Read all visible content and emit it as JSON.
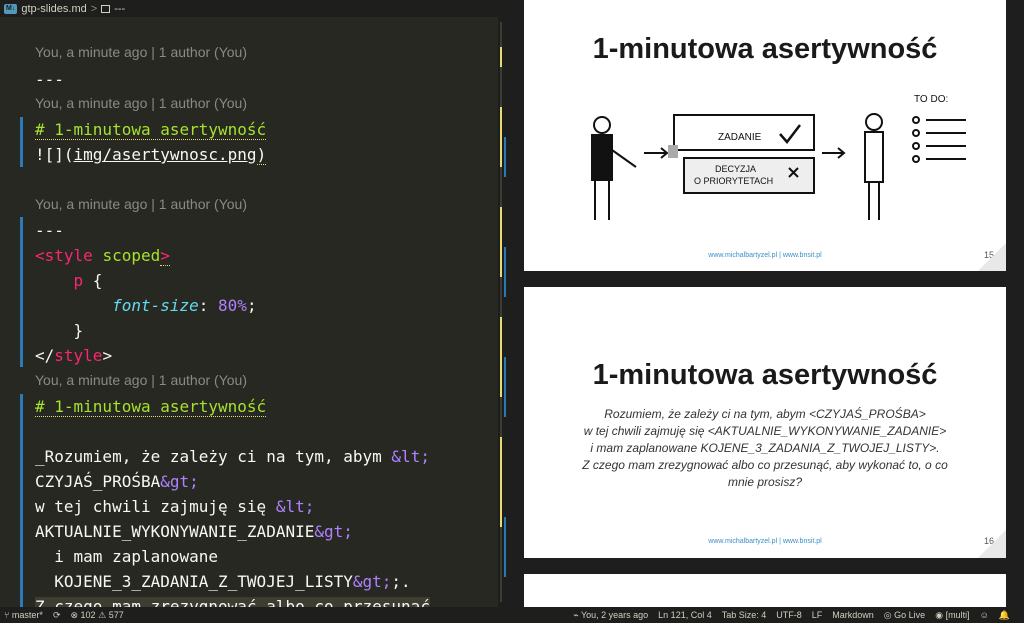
{
  "tab": {
    "filename": "gtp-slides.md",
    "breadcrumb_sep": ">",
    "breadcrumb_more": "---",
    "badge": "M↓"
  },
  "blame": {
    "b1": "You, a minute ago | 1 author (You)",
    "b2": "You, a minute ago | 1 author (You)",
    "b3": "You, a minute ago | 1 author (You)",
    "b4": "You, a minute ago | 1 author (You)"
  },
  "code": {
    "sep1": "---",
    "heading1": "# 1-minutowa asertywność",
    "img_prefix": "![](",
    "img_path": "img/asertywnosc.png",
    "img_suffix": ")",
    "sep2": "---",
    "style_lt": "<",
    "style_tag": "style",
    "style_attr": "scoped",
    "style_gt": ">",
    "p_sel": "p",
    "p_brace": " {",
    "fs_prop": "font-size",
    "fs_colon": ": ",
    "fs_val": "80%",
    "fs_semi": ";",
    "close_brace": "}",
    "style_close_lt": "</",
    "style_close_tag": "style",
    "style_close_gt": ">",
    "heading2": "# 1-minutowa asertywność",
    "t1a": "_Rozumiem, że zależy ci na tym, abym ",
    "t1b": "&lt;",
    "t2a": "CZYJAŚ_PROŚBA",
    "t2b": "&gt;",
    "t2c": ";",
    "t3a": "w tej chwili zajmuję się ",
    "t3b": "&lt;",
    "t4a": "AKTUALNIE_WYKONYWANIE_ZADANIE",
    "t4b": "&gt;",
    "t5": "  i mam zaplanowane",
    "t6a": "  KOJENE_3_ZADANIA_Z_TWOJEJ_LISTY",
    "t6b": "&gt;",
    "t6c": ";.",
    "t7": "Z czego mam zrezygnować albo co przesunąć"
  },
  "slide15": {
    "title": "1-minutowa asertywność",
    "todo": "TO DO:",
    "zadanie": "ZADANIE",
    "decyzja1": "DECYZJA",
    "decyzja2": "O PRIORYTETACH",
    "footer": "www.michalbartyzel.pl | www.bnsit.pl",
    "number": "15"
  },
  "slide16": {
    "title": "1-minutowa asertywność",
    "line1": "Rozumiem, że zależy ci na tym, abym <CZYJAŚ_PROŚBA>",
    "line2": "w tej chwili zajmuję się <AKTUALNIE_WYKONYWANIE_ZADANIE>",
    "line3": "i mam zaplanowane KOJENE_3_ZADANIA_Z_TWOJEJ_LISTY>.",
    "line4": "Z czego mam zrezygnować albo co przesunąć, aby wykonać to, o co",
    "line5": "mnie prosisz?",
    "footer": "www.michalbartyzel.pl | www.bnsit.pl",
    "number": "16"
  },
  "status": {
    "branch": "master*",
    "errors": "0",
    "errors_icon": "⊗",
    "warnings": "102",
    "warnings_icon": "⚠",
    "info": "577",
    "blame": "You, 2 years ago",
    "position": "Ln 121, Col 4",
    "tab_size": "Tab Size: 4",
    "encoding": "UTF-8",
    "eol": "LF",
    "language": "Markdown",
    "golive": "Go Live",
    "multi": "[multi]"
  },
  "colors": {
    "bg": "#272822",
    "heading": "#a6e22e",
    "tag": "#f92672",
    "prop": "#66d9ef",
    "num": "#ae81ff",
    "accent": "#2b79b8"
  }
}
